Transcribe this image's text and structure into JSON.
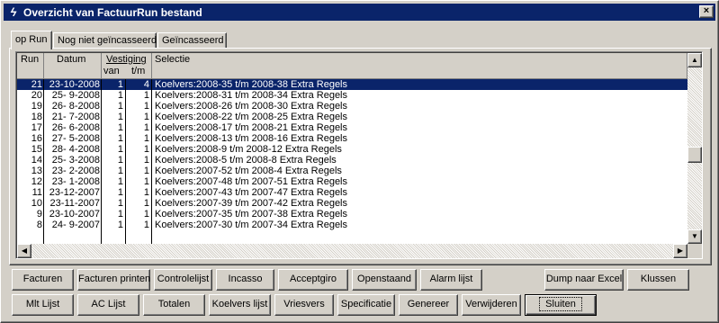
{
  "window": {
    "title": "Overzicht van FactuurRun bestand",
    "close_glyph": "×",
    "app_icon": "lightning-icon"
  },
  "tabs": [
    {
      "label": "op Run",
      "active": true
    },
    {
      "label": "Nog niet geïncasseerd",
      "active": false
    },
    {
      "label": "Geïncasseerd",
      "active": false
    }
  ],
  "grid": {
    "headers": {
      "run": "Run",
      "datum": "Datum",
      "vestiging": "Vestiging",
      "van": "van",
      "tm": "t/m",
      "selectie": "Selectie"
    },
    "rows": [
      {
        "run": "21",
        "datum": "23-10-2008",
        "van": "1",
        "tm": "4",
        "selectie": "Koelvers:2008-35 t/m 2008-38 Extra Regels",
        "selected": true
      },
      {
        "run": "20",
        "datum": "25- 9-2008",
        "van": "1",
        "tm": "1",
        "selectie": "Koelvers:2008-31 t/m 2008-34 Extra Regels"
      },
      {
        "run": "19",
        "datum": "26- 8-2008",
        "van": "1",
        "tm": "1",
        "selectie": "Koelvers:2008-26 t/m 2008-30 Extra Regels"
      },
      {
        "run": "18",
        "datum": "21- 7-2008",
        "van": "1",
        "tm": "1",
        "selectie": "Koelvers:2008-22 t/m 2008-25 Extra Regels"
      },
      {
        "run": "17",
        "datum": "26- 6-2008",
        "van": "1",
        "tm": "1",
        "selectie": "Koelvers:2008-17 t/m 2008-21 Extra Regels"
      },
      {
        "run": "16",
        "datum": "27- 5-2008",
        "van": "1",
        "tm": "1",
        "selectie": "Koelvers:2008-13 t/m 2008-16 Extra Regels"
      },
      {
        "run": "15",
        "datum": "28- 4-2008",
        "van": "1",
        "tm": "1",
        "selectie": "Koelvers:2008-9 t/m 2008-12 Extra Regels"
      },
      {
        "run": "14",
        "datum": "25- 3-2008",
        "van": "1",
        "tm": "1",
        "selectie": "Koelvers:2008-5 t/m 2008-8 Extra Regels"
      },
      {
        "run": "13",
        "datum": "23- 2-2008",
        "van": "1",
        "tm": "1",
        "selectie": "Koelvers:2007-52 t/m 2008-4 Extra Regels"
      },
      {
        "run": "12",
        "datum": "23- 1-2008",
        "van": "1",
        "tm": "1",
        "selectie": "Koelvers:2007-48 t/m 2007-51 Extra Regels"
      },
      {
        "run": "11",
        "datum": "23-12-2007",
        "van": "1",
        "tm": "1",
        "selectie": "Koelvers:2007-43 t/m 2007-47 Extra Regels"
      },
      {
        "run": "10",
        "datum": "23-11-2007",
        "van": "1",
        "tm": "1",
        "selectie": "Koelvers:2007-39 t/m 2007-42 Extra Regels"
      },
      {
        "run": "9",
        "datum": "23-10-2007",
        "van": "1",
        "tm": "1",
        "selectie": "Koelvers:2007-35 t/m 2007-38 Extra Regels"
      },
      {
        "run": "8",
        "datum": "24- 9-2007",
        "van": "1",
        "tm": "1",
        "selectie": "Koelvers:2007-30 t/m 2007-34 Extra Regels"
      }
    ]
  },
  "scroll": {
    "up": "▲",
    "down": "▼",
    "left": "◀",
    "right": "▶"
  },
  "buttons_row1": [
    {
      "id": "facturen",
      "label": "Facturen"
    },
    {
      "id": "facturen-printen",
      "label": "Facturen printen"
    },
    {
      "id": "controlelijst",
      "label": "Controlelijst"
    },
    {
      "id": "incasso",
      "label": "Incasso"
    },
    {
      "id": "acceptgiro",
      "label": "Acceptgiro"
    },
    {
      "id": "openstaand",
      "label": "Openstaand"
    },
    {
      "id": "alarm-lijst",
      "label": "Alarm lijst"
    },
    {
      "id": "dump-naar-excel",
      "label": "Dump naar Excel"
    },
    {
      "id": "klussen",
      "label": "Klussen"
    }
  ],
  "buttons_row2": [
    {
      "id": "mlt-lijst",
      "label": "Mlt Lijst"
    },
    {
      "id": "ac-lijst",
      "label": "AC Lijst"
    },
    {
      "id": "totalen",
      "label": "Totalen"
    },
    {
      "id": "koelvers-lijst",
      "label": "Koelvers lijst"
    },
    {
      "id": "vriesvers",
      "label": "Vriesvers"
    },
    {
      "id": "specificatie",
      "label": "Specificatie"
    },
    {
      "id": "genereer",
      "label": "Genereer"
    },
    {
      "id": "verwijderen",
      "label": "Verwijderen"
    },
    {
      "id": "sluiten",
      "label": "Sluiten",
      "default": true
    }
  ]
}
